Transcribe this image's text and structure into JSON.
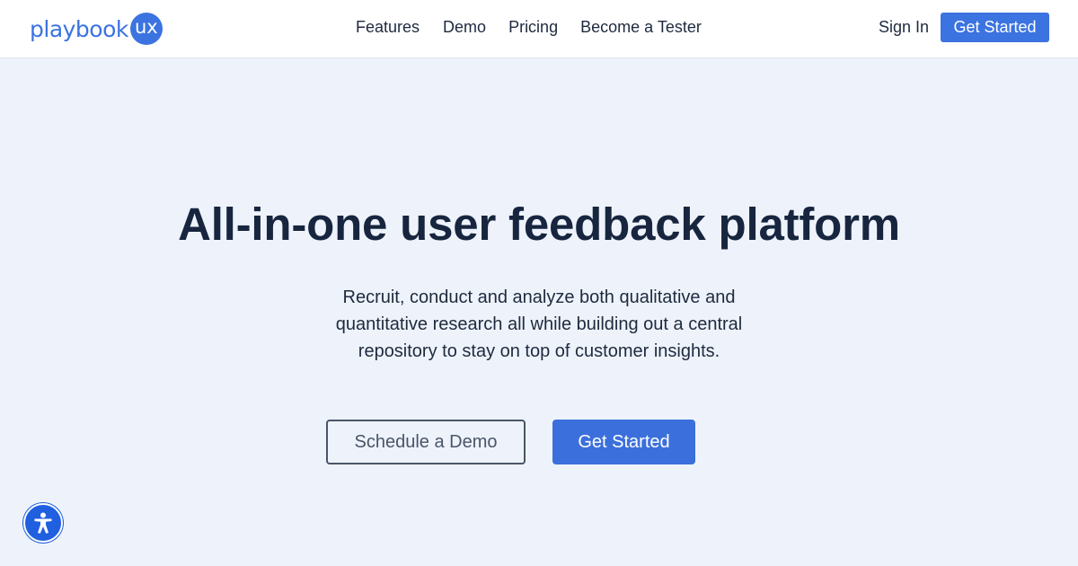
{
  "colors": {
    "brand": "#3b73e0",
    "heading": "#17253f",
    "page_background": "#eef3fb",
    "accessibility_button": "#1f5fe0"
  },
  "logo": {
    "word": "playbook",
    "badge": "ux"
  },
  "nav": {
    "links": [
      "Features",
      "Demo",
      "Pricing",
      "Become a Tester"
    ],
    "sign_in": "Sign In",
    "cta": "Get Started"
  },
  "hero": {
    "title": "All-in-one user feedback platform",
    "subtitle_lines": [
      "Recruit, conduct and analyze both qualitative and",
      "quantitative research all while building out a central",
      "repository to stay on top of customer insights."
    ],
    "secondary_button": "Schedule a Demo",
    "primary_button": "Get Started"
  },
  "accessibility": {
    "icon": "accessibility-person-icon"
  }
}
